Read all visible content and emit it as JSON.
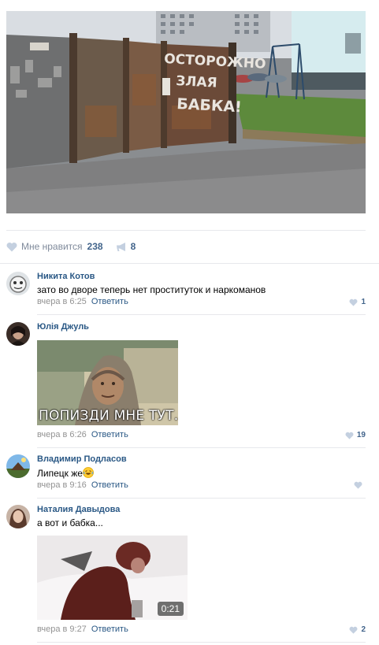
{
  "post": {
    "photo_text_lines": [
      "ОСТОРОЖНО",
      "ЗЛАЯ",
      "БАБКА!"
    ],
    "likes_label": "Мне нравится",
    "likes_count": "238",
    "shares_count": "8",
    "icons": {
      "like": "heart-icon",
      "share": "megaphone-icon"
    }
  },
  "comments": [
    {
      "author": "Никита Котов",
      "text": "зато во дворе теперь нет проституток и наркоманов",
      "time": "вчера в 6:25",
      "reply_label": "Ответить",
      "likes": "1"
    },
    {
      "author": "Юлія Джуль",
      "text": "",
      "attachment_caption": "ПОПИЗДИ МНЕ ТУТ...",
      "time": "вчера в 6:26",
      "reply_label": "Ответить",
      "likes": "19"
    },
    {
      "author": "Владимир Подласов",
      "text": "Липецк же",
      "emoji": "laughing-face-emoji",
      "time": "вчера в 9:16",
      "reply_label": "Ответить",
      "likes": ""
    },
    {
      "author": "Наталия Давыдова",
      "text": "а вот и бабка...",
      "video_duration": "0:21",
      "time": "вчера в 9:27",
      "reply_label": "Ответить",
      "likes": "2"
    }
  ],
  "colors": {
    "link": "#2a5885",
    "meta": "#939393",
    "like_icon": "#c4d0e0",
    "divider": "#e7e8ec"
  }
}
